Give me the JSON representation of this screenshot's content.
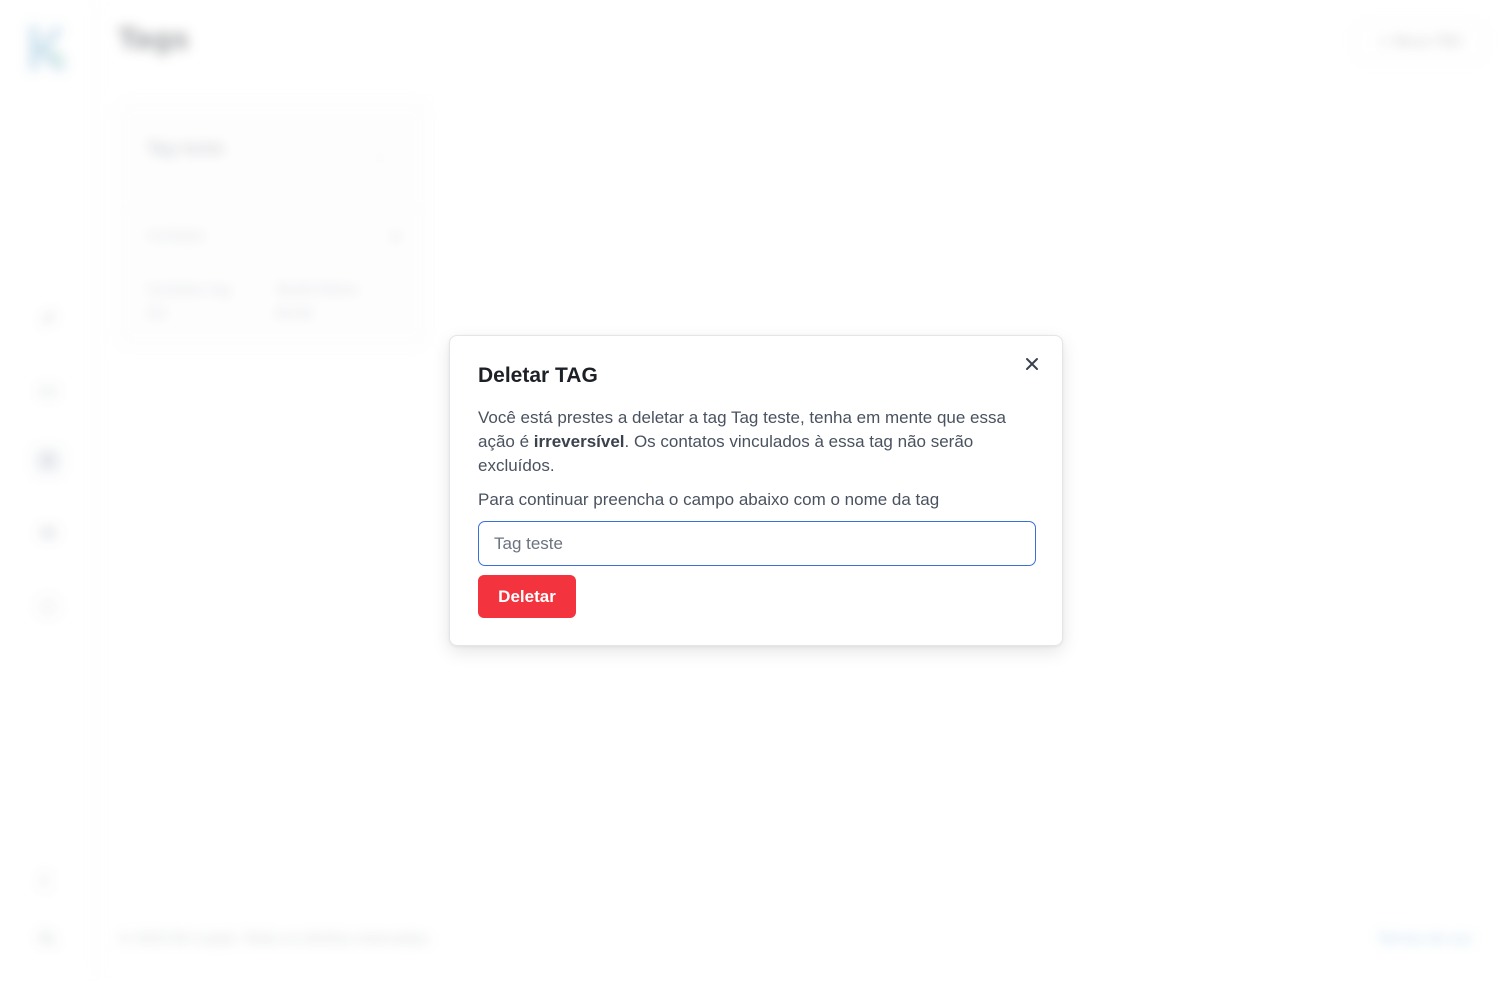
{
  "app": {
    "page_title": "Tags",
    "new_tag_label": "+ Nova TAG",
    "footer_copyright": "© 2023 Kiri Leads. Todos os direitos reservados.",
    "footer_link": "Termos de uso"
  },
  "tag_card": {
    "name": "Tag teste",
    "menu_glyph": "⋮",
    "section_label": "Contatos",
    "section_add": "+",
    "stat_1_label": "Contatos tag",
    "stat_1_value": "0/1",
    "stat_2_label": "Tarefa Diária",
    "stat_2_value": "00:00"
  },
  "sidebar": {
    "icons": [
      {
        "name": "rocket-icon",
        "glyph": "➚"
      },
      {
        "name": "chat-icon",
        "glyph": "▭"
      },
      {
        "name": "tag-icon",
        "glyph": "⌘"
      },
      {
        "name": "mail-icon",
        "glyph": "✉"
      },
      {
        "name": "help-icon",
        "glyph": "ⓘ"
      },
      {
        "name": "moon-icon",
        "glyph": "☾"
      },
      {
        "name": "avatar-icon",
        "glyph": "KL"
      }
    ]
  },
  "modal": {
    "title": "Deletar TAG",
    "text_before": "Você está prestes a deletar a tag Tag teste, tenha em mente que essa ação é ",
    "text_bold": "irreversível",
    "text_after": ". Os contatos vinculados à essa tag não serão excluídos.",
    "instruction": "Para continuar preencha o campo abaixo com o nome da tag",
    "input_placeholder": "Tag teste",
    "input_value": "",
    "delete_label": "Deletar"
  },
  "colors": {
    "danger": "#f3333e",
    "focus_border": "#3b6fd8",
    "brand_logo": "#6aa7c8"
  }
}
